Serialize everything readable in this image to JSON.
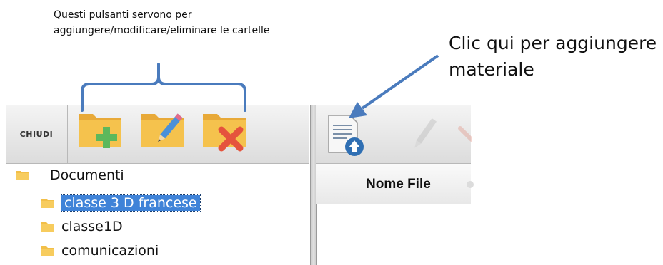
{
  "annotations": {
    "folder_buttons_note": "Questi pulsanti servono per aggiungere/modificare/eliminare le cartelle",
    "add_material_note": "Clic qui per aggiungere materiale"
  },
  "toolbar": {
    "close_label": "CHIUDI",
    "buttons": [
      "add-folder-icon",
      "edit-folder-icon",
      "delete-folder-icon"
    ]
  },
  "right_toolbar": {
    "buttons": [
      "add-material-icon",
      "edit-icon",
      "delete-icon"
    ]
  },
  "tree": {
    "root": "Documenti",
    "items": [
      "classe 3 D francese",
      "classe1D",
      "comunicazioni"
    ],
    "selected": "classe 3 D francese"
  },
  "file_table": {
    "columns": [
      "Nome File"
    ]
  },
  "colors": {
    "annotation_blue": "#4a7bbd",
    "folder_yellow": "#f2bf48",
    "selection_blue": "#3f83d8",
    "add_green": "#5cb85c",
    "delete_red": "#e5533d"
  }
}
